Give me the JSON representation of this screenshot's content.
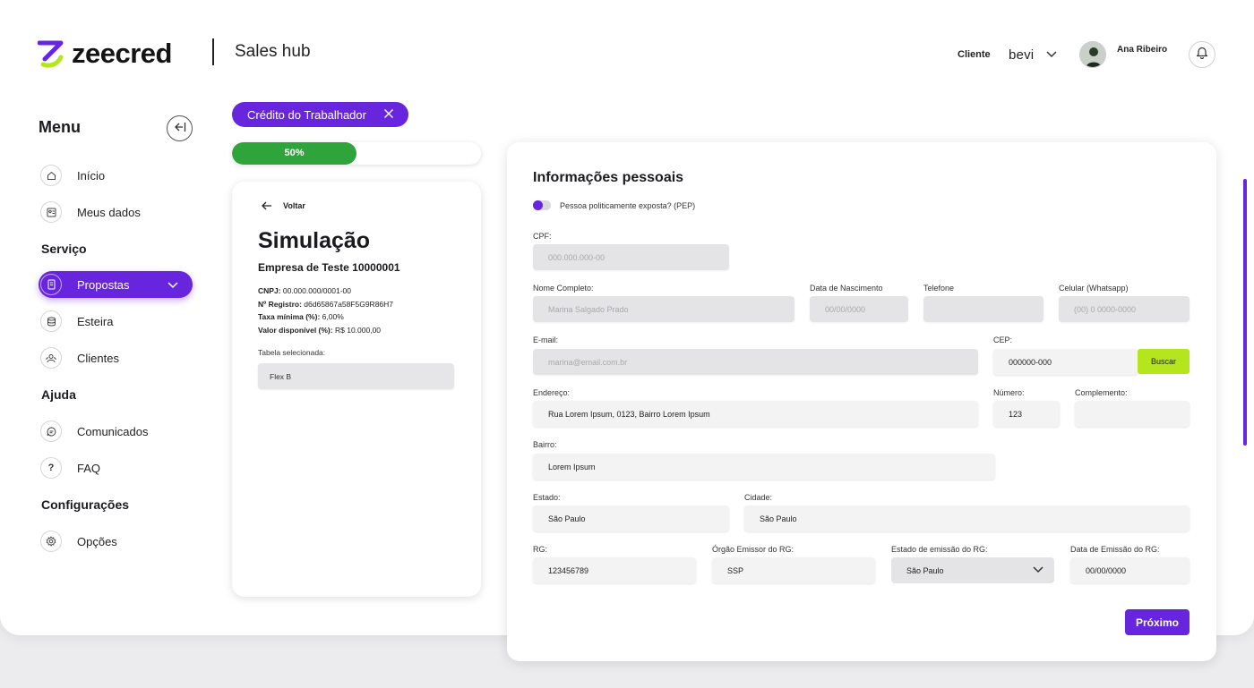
{
  "brand": {
    "name": "zeecred",
    "product": "Sales hub"
  },
  "header": {
    "client_label": "Cliente",
    "client_value": "bevi",
    "user_name": "Ana Ribeiro"
  },
  "sidebar": {
    "title": "Menu",
    "items": [
      {
        "label": "Início",
        "icon": "home-icon"
      },
      {
        "label": "Meus dados",
        "icon": "id-card-icon"
      }
    ],
    "sections": {
      "servico": "Serviço",
      "ajuda": "Ajuda",
      "config": "Configurações"
    },
    "servico_items": [
      {
        "label": "Propostas",
        "icon": "document-icon",
        "active": true
      },
      {
        "label": "Esteira",
        "icon": "database-icon"
      },
      {
        "label": "Clientes",
        "icon": "users-icon"
      }
    ],
    "ajuda_items": [
      {
        "label": "Comunicados",
        "icon": "chat-icon"
      },
      {
        "label": "FAQ",
        "icon": "question-icon"
      }
    ],
    "config_items": [
      {
        "label": "Opções",
        "icon": "gear-icon"
      }
    ]
  },
  "chip": {
    "label": "Crédito do Trabalhador"
  },
  "progress": {
    "value": 0.5,
    "label": "50%"
  },
  "simulation": {
    "back_label": "Voltar",
    "title": "Simulação",
    "company": "Empresa de Teste 10000001",
    "cnpj_label": "CNPJ:",
    "cnpj_value": "00.000.000/0001-00",
    "registro_label": "Nº Registro:",
    "registro_value": "d6d65867a58F5G9R86H7",
    "taxa_label": "Taxa mínima (%):",
    "taxa_value": "6,00%",
    "valor_label": "Valor disponível (%):",
    "valor_value": "R$ 10.000,00",
    "tabela_label": "Tabela selecionada:",
    "tabela_value": "Flex B"
  },
  "form": {
    "title": "Informações pessoais",
    "pep_label": "Pessoa politicamente exposta? (PEP)",
    "cpf": {
      "label": "CPF:",
      "value": "000.000.000-00"
    },
    "nome": {
      "label": "Nome Completo:",
      "value": "Marina Salgado Prado"
    },
    "nascimento": {
      "label": "Data de Nascimento",
      "value": "00/00/0000"
    },
    "telefone": {
      "label": "Telefone",
      "value": ""
    },
    "celular": {
      "label": "Celular (Whatsapp)",
      "value": "(00) 0 0000-0000"
    },
    "email": {
      "label": "E-mail:",
      "value": "marina@email.com.br"
    },
    "cep": {
      "label": "CEP:",
      "value": "000000-000"
    },
    "buscar_label": "Buscar",
    "endereco": {
      "label": "Endereço:",
      "value": "Rua Lorem Ipsum, 0123, Bairro Lorem Ipsum"
    },
    "numero": {
      "label": "Número:",
      "value": "123"
    },
    "complemento": {
      "label": "Complemento:",
      "value": ""
    },
    "bairro": {
      "label": "Bairro:",
      "value": "Lorem Ipsum"
    },
    "estado": {
      "label": "Estado:",
      "value": "São Paulo"
    },
    "cidade": {
      "label": "Cidade:",
      "value": "São Paulo"
    },
    "rg": {
      "label": "RG:",
      "value": "123456789"
    },
    "orgao": {
      "label": "Órgão Emissor do RG:",
      "value": "SSP"
    },
    "estado_rg": {
      "label": "Estado de emissão do RG:",
      "value": "São Paulo"
    },
    "data_rg": {
      "label": "Data de Emissão do RG:",
      "value": "00/00/0000"
    },
    "next_label": "Próximo"
  },
  "colors": {
    "accent": "#6725de",
    "progress": "#2ea43b",
    "lime": "#b5e61d"
  }
}
